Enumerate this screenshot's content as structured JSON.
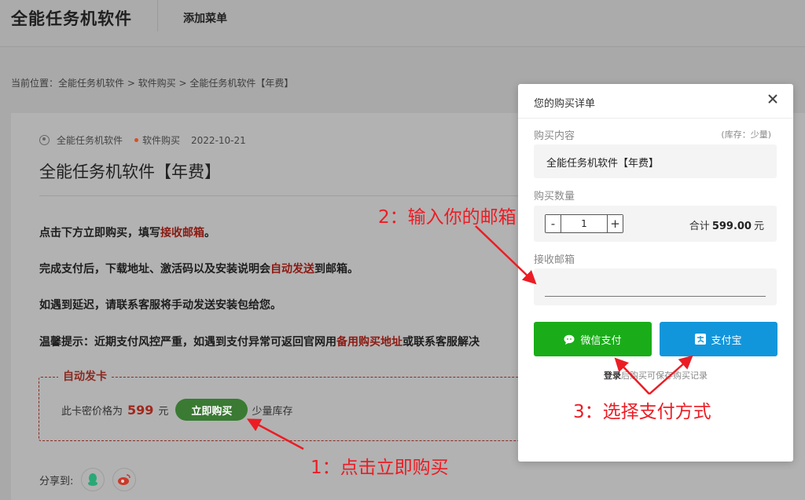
{
  "header": {
    "logo": "全能任务机软件",
    "nav_add": "添加菜单"
  },
  "breadcrumb": "当前位置：全能任务机软件 > 软件购买 > 全能任务机软件【年费】",
  "article": {
    "author": "全能任务机软件",
    "category": "软件购买",
    "date": "2022-10-21",
    "title": "全能任务机软件【年费】",
    "p1_before": "点击下方立即购买，填写",
    "p1_hl": "接收邮箱",
    "p1_after": "。",
    "p2_before": "完成支付后，下载地址、激活码以及安装说明会",
    "p2_hl": "自动发送",
    "p2_after": "到邮箱。",
    "p3": "如遇到延迟，请联系客服将手动发送安装包给您。",
    "p4_before": "温馨提示：近期支付风控严重，如遇到支付异常可返回官网用",
    "p4_hl": "备用购买地址",
    "p4_after": "或联系客服解决",
    "auto_legend": "自动发卡",
    "price_prefix": "此卡密价格为",
    "price": "599",
    "price_unit": "元",
    "buy_now": "立即购买",
    "stock_low": "少量库存",
    "share_label": "分享到:"
  },
  "modal": {
    "title": "您的购买详单",
    "content_label": "购买内容",
    "stock_tag": "(库存：少量)",
    "content_value": "全能任务机软件【年费】",
    "qty_label": "购买数量",
    "qty_minus": "-",
    "qty_value": "1",
    "qty_plus": "+",
    "total_prefix": "合计",
    "total_value": "599.00",
    "total_unit": "元",
    "email_label": "接收邮箱",
    "email_placeholder": "",
    "wechat": "微信支付",
    "alipay": "支付宝",
    "login_bold": "登录",
    "login_rest": "后购买可保存购买记录"
  },
  "annotations": {
    "a1": "1：点击立即购买",
    "a2": "2：输入你的邮箱",
    "a3": "3：选择支付方式"
  },
  "colors": {
    "wechat": "#1aad19",
    "alipay": "#1296db",
    "annotation": "#ec1c24",
    "highlight": "#8b1a12",
    "buy": "#3a7a33"
  }
}
